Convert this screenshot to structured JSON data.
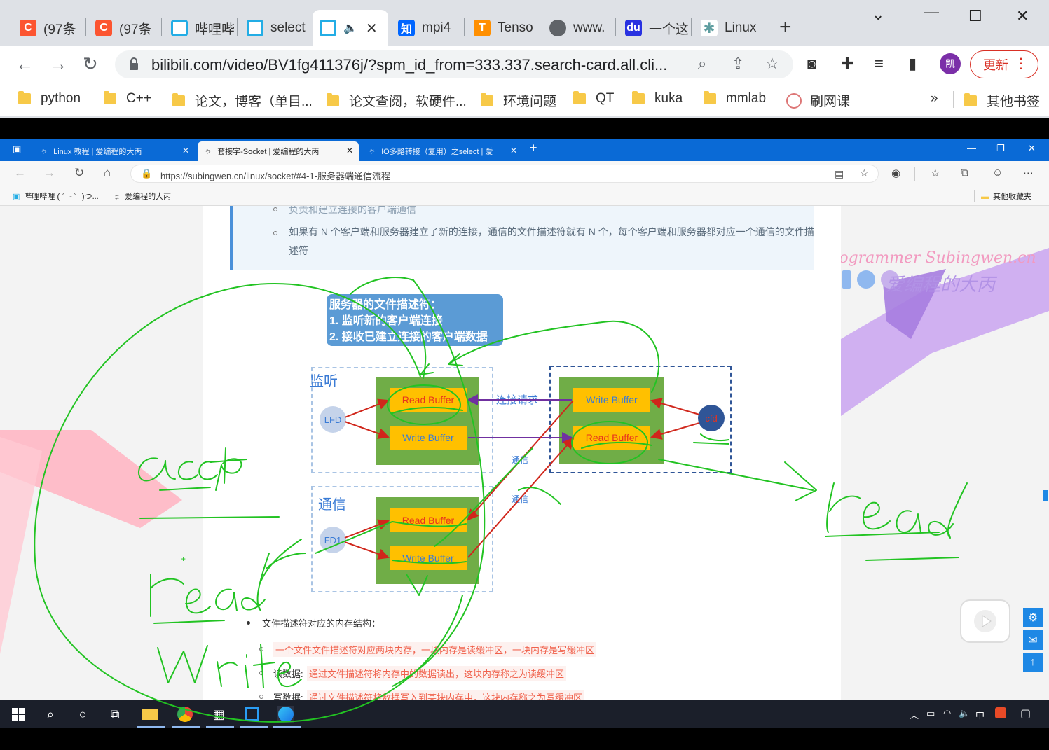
{
  "outer_tabs": [
    {
      "label": "(97条",
      "icon": "csdn-icon",
      "color": "#fc5531"
    },
    {
      "label": "(97条",
      "icon": "csdn-icon",
      "color": "#fc5531"
    },
    {
      "label": "哔哩哔",
      "icon": "bilibili-icon",
      "color": "#23ade5"
    },
    {
      "label": "select",
      "icon": "bilibili-icon",
      "color": "#23ade5"
    },
    {
      "label": "",
      "icon": "bilibili-icon",
      "color": "#23ade5"
    },
    {
      "label": "mpi4",
      "icon": "zhihu-icon",
      "color": "#0066ff"
    },
    {
      "label": "Tenso",
      "icon": "tensorflow-icon",
      "color": "#ff8f00"
    },
    {
      "label": "www.",
      "icon": "globe-icon",
      "color": "#5f6368"
    },
    {
      "label": "一个这",
      "icon": "baidu-icon",
      "color": "#2932e1"
    },
    {
      "label": "Linux",
      "icon": "gear-icon",
      "color": "#5f9ea0"
    }
  ],
  "outer_url": "bilibili.com/video/BV1fg411376j/?spm_id_from=333.337.search-card.all.cli...",
  "avatar_text": "凯",
  "update_label": "更新",
  "bookmarks": [
    "python",
    "C++",
    "论文，博客（单目...",
    "论文查阅，软硬件...",
    "环境问题",
    "QT",
    "kuka",
    "mmlab",
    "刷网课"
  ],
  "bookmarks_more": "»",
  "other_bookmarks": "其他书签",
  "inner_tabs": [
    {
      "label": "Linux 教程 | 爱编程的大丙"
    },
    {
      "label": "套接字-Socket | 爱编程的大丙"
    },
    {
      "label": "IO多路转接（复用）之select | 爱"
    }
  ],
  "inner_url": "https://subingwen.cn/linux/socket/#4-1-服务器端通信流程",
  "inner_bookmarks": [
    "哔哩哔哩 ( ゜- ゜)つ...",
    "爱编程的大丙"
  ],
  "inner_other_bookmarks": "其他收藏夹",
  "note": {
    "line0": "负责和建立连接的客户端通信",
    "line1": "如果有 N 个客户端和服务器建立了新的连接，通信的文件描述符就有 N 个，每个客户端和服务器都对应一个通信的文件描",
    "line2": "述符"
  },
  "diagram": {
    "desc_title": "服务器的文件描述符：",
    "desc_1": "1. 监听新的客户端连接",
    "desc_2": "2. 接收已建立连接的客户端数据",
    "listen_label": "监听",
    "comm_label": "通信",
    "lfd": "LFD",
    "fd1": "FD1",
    "cfd": "cfd",
    "read_buffer": "Read Buffer",
    "write_buffer": "Write Buffer",
    "conn_request": "连接请求",
    "comm_small": "通信"
  },
  "list": {
    "heading": "文件描述符对应的内存结构：",
    "item1": "一个文件文件描述符对应两块内存，一块内存是读缓冲区，一块内存是写缓冲区",
    "item2_prefix": "读数据:",
    "item2": "通过文件描述符将内存中的数据读出，这块内存称之为读缓冲区",
    "item3_prefix": "写数据:",
    "item3": "通过文件描述符将数据写入到某块内存中，这块内存称之为写缓冲区"
  },
  "logo": {
    "line1": "Programmer Subingwen.cn",
    "line2": "爱编程的大丙"
  },
  "tray": {
    "ime": "中"
  },
  "colors": {
    "ink": "#22c322",
    "inner_tab_bar": "#0a6ad6",
    "buffer": "#ffc000",
    "group": "#70ad47"
  }
}
